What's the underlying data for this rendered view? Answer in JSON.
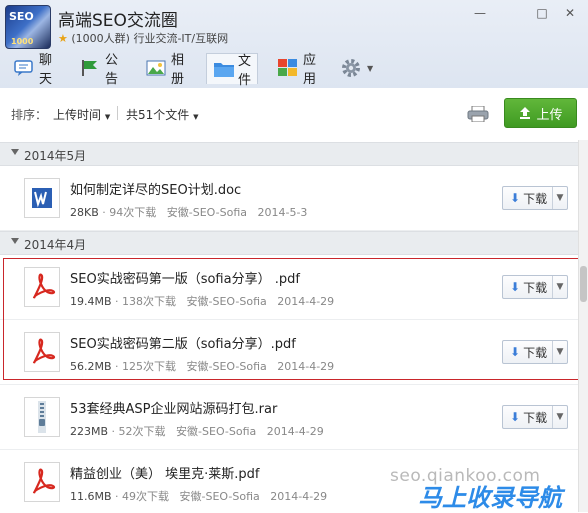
{
  "window": {
    "title": "高端SEO交流圈",
    "subtitle": "(1000人群) 行业交流-IT/互联网",
    "logo_text": "SEO",
    "logo_number": "1000",
    "buttons": {
      "minimize": "—",
      "maximize": "□",
      "close": "✕"
    }
  },
  "tabs": [
    {
      "label": "聊天"
    },
    {
      "label": "公告"
    },
    {
      "label": "相册"
    },
    {
      "label": "文件"
    },
    {
      "label": "应用"
    }
  ],
  "toolbar": {
    "sort_label": "排序：",
    "sort_value": "上传时间",
    "count": "共51个文件",
    "upload_label": "上传"
  },
  "groups": [
    {
      "label": "2014年5月"
    },
    {
      "label": "2014年4月"
    }
  ],
  "files": [
    {
      "name": "如何制定详尽的SEO计划.doc",
      "size": "28KB",
      "downloads": "94次下载",
      "uploader": "安徽-SEO-Sofia",
      "date": "2014-5-3",
      "type": "doc"
    },
    {
      "name": "SEO实战密码第一版（sofia分享） .pdf",
      "size": "19.4MB",
      "downloads": "138次下载",
      "uploader": "安徽-SEO-Sofia",
      "date": "2014-4-29",
      "type": "pdf"
    },
    {
      "name": "SEO实战密码第二版（sofia分享）.pdf",
      "size": "56.2MB",
      "downloads": "125次下载",
      "uploader": "安徽-SEO-Sofia",
      "date": "2014-4-29",
      "type": "pdf"
    },
    {
      "name": "53套经典ASP企业网站源码打包.rar",
      "size": "223MB",
      "downloads": "52次下载",
      "uploader": "安徽-SEO-Sofia",
      "date": "2014-4-29",
      "type": "rar"
    },
    {
      "name": "精益创业（美） 埃里克·莱斯.pdf",
      "size": "11.6MB",
      "downloads": "49次下载",
      "uploader": "安徽-SEO-Sofia",
      "date": "2014-4-29",
      "type": "pdf"
    }
  ],
  "download_label": "下载",
  "watermark": {
    "url": "seo.qiankoo.com",
    "brand": "马上收录导航"
  },
  "colors": {
    "accent_green": "#4aa82a",
    "highlight_red": "#c9262b",
    "pdf_red": "#d7281f",
    "word_blue": "#2b5fb4"
  }
}
